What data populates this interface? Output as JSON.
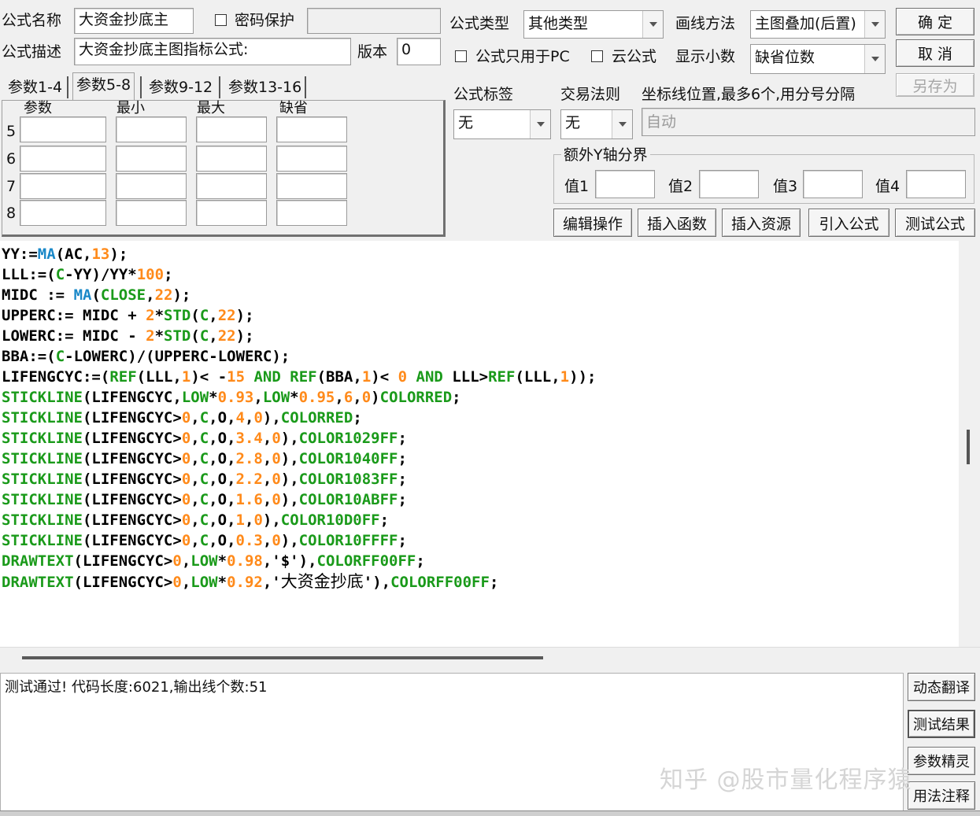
{
  "top": {
    "name_label": "公式名称",
    "name_value": "大资金抄底主",
    "password_label": "密码保护",
    "desc_label": "公式描述",
    "desc_value": "大资金抄底主图指标公式:",
    "version_label": "版本",
    "version_value": "0",
    "type_label": "公式类型",
    "type_value": "其他类型",
    "draw_label": "画线方法",
    "draw_value": "主图叠加(后置)",
    "pc_only_label": "公式只用于PC",
    "cloud_label": "云公式",
    "decimals_label": "显示小数",
    "decimals_value": "缺省位数"
  },
  "buttons": {
    "ok": "确  定",
    "cancel": "取  消",
    "save_as": "另存为",
    "edit_ops": "编辑操作",
    "insert_func": "插入函数",
    "insert_res": "插入资源",
    "import_formula": "引入公式",
    "test_formula": "测试公式",
    "dyn_translate": "动态翻译",
    "test_result": "测试结果",
    "param_wizard": "参数精灵",
    "usage_notes": "用法注释"
  },
  "tabs": [
    "参数1-4",
    "参数5-8",
    "参数9-12",
    "参数13-16"
  ],
  "params": {
    "headers": [
      "参数",
      "最小",
      "最大",
      "缺省"
    ],
    "rows": [
      "5",
      "6",
      "7",
      "8"
    ]
  },
  "right": {
    "tag_label": "公式标签",
    "tag_value": "无",
    "rule_label": "交易法则",
    "rule_value": "无",
    "axis_label": "坐标线位置,最多6个,用分号分隔",
    "axis_value": "自动",
    "yaxis_group": "额外Y轴分界",
    "val1": "值1",
    "val2": "值2",
    "val3": "值3",
    "val4": "值4"
  },
  "code_lines": [
    "YY:=MA(AC,13);",
    "LLL:=(C-YY)/YY*100;",
    "MIDC := MA(CLOSE,22);",
    "UPPERC:= MIDC + 2*STD(C,22);",
    "LOWERC:= MIDC - 2*STD(C,22);",
    "BBA:=(C-LOWERC)/(UPPERC-LOWERC);",
    "LIFENGCYC:=(REF(LLL,1)< -15 AND REF(BBA,1)< 0 AND LLL>REF(LLL,1));",
    "STICKLINE(LIFENGCYC,LOW*0.93,LOW*0.95,6,0)COLORRED;",
    "STICKLINE(LIFENGCYC>0,C,O,4,0),COLORRED;",
    "STICKLINE(LIFENGCYC>0,C,O,3.4,0),COLOR1029FF;",
    "STICKLINE(LIFENGCYC>0,C,O,2.8,0),COLOR1040FF;",
    "STICKLINE(LIFENGCYC>0,C,O,2.2,0),COLOR1083FF;",
    "STICKLINE(LIFENGCYC>0,C,O,1.6,0),COLOR10ABFF;",
    "STICKLINE(LIFENGCYC>0,C,O,1,0),COLOR10D0FF;",
    "STICKLINE(LIFENGCYC>0,C,O,0.3,0),COLOR10FFFF;",
    "DRAWTEXT(LIFENGCYC>0,LOW*0.98,'$'),COLORFF00FF;",
    "DRAWTEXT(LIFENGCYC>0,LOW*0.92,'大资金抄底'),COLORFF00FF;"
  ],
  "output": {
    "message": "测试通过! 代码长度:6021,输出线个数:51"
  },
  "watermark": "知乎 @股市量化程序猿",
  "colors": {
    "keyword": "#1a9a1a",
    "function": "#1a88c8",
    "number": "#ff8a1a"
  }
}
